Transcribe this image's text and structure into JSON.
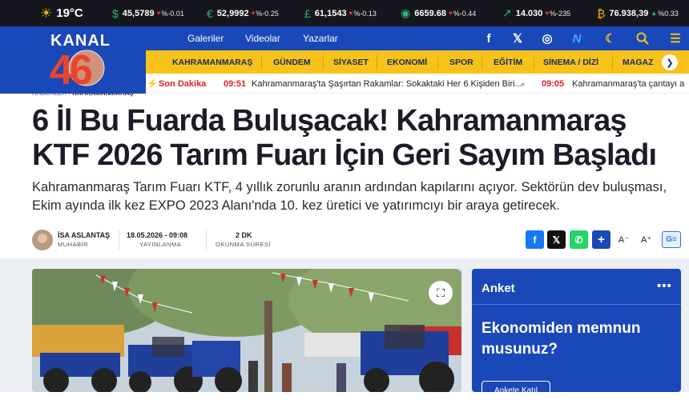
{
  "ticker": {
    "weather": {
      "temp": "19°C",
      "icon": "sun-icon"
    },
    "items": [
      {
        "icon": "dollar-icon",
        "symbol": "$",
        "value": "45,5789",
        "change": "%-0.01",
        "dir": "down"
      },
      {
        "icon": "euro-icon",
        "symbol": "€",
        "value": "52,9992",
        "change": "%-0.25",
        "dir": "down"
      },
      {
        "icon": "pound-icon",
        "symbol": "£",
        "value": "61,1543",
        "change": "%-0.13",
        "dir": "down"
      },
      {
        "icon": "gold-icon",
        "symbol": "◉",
        "value": "6659.68",
        "change": "%-0.44",
        "dir": "down"
      },
      {
        "icon": "chart-icon",
        "symbol": "↗",
        "value": "14.030",
        "change": "%-235",
        "dir": "down"
      },
      {
        "icon": "bitcoin-icon",
        "symbol": "₿",
        "value": "76.938,39",
        "change": "%0.33",
        "dir": "up"
      }
    ]
  },
  "header": {
    "logo_top": "KANAL",
    "logo_num": "46",
    "nav": [
      "Galeriler",
      "Videolar",
      "Yazarlar"
    ]
  },
  "categories": [
    "KAHRAMANMARAŞ",
    "GÜNDEM",
    "SİYASET",
    "EKONOMİ",
    "SPOR",
    "EĞİTİM",
    "SİNEMA / DİZİ",
    "MAGAZ"
  ],
  "breaking": {
    "label": "Son Dakika",
    "items": [
      {
        "time": "09:51",
        "text": "Kahramanmaraş'ta Şaşırtan Rakamlar: Sokaktaki Her 6 Kişiden Biri..."
      },
      {
        "time": "09:05",
        "text": "Kahramanmaraş'ta çantayı a"
      }
    ]
  },
  "breadcrumb": {
    "home": "HABERLER",
    "sep": "›",
    "current": "KAHRAMANMARAŞ"
  },
  "article": {
    "title": "6 İl Bu Fuarda Buluşacak! Kahramanmaraş KTF 2026 Tarım Fuarı İçin Geri Sayım Başladı",
    "spot": "Kahramanmaraş Tarım Fuarı KTF, 4 yıllık zorunlu aranın ardından kapılarını açıyor. Sektörün dev buluşması, Ekim ayında ilk kez EXPO 2023 Alanı'nda 10. kez üretici ve yatırımcıyı bir araya getirecek."
  },
  "meta": {
    "author": "İSA ASLANTAŞ",
    "role": "MUHABİR",
    "date": "18.05.2026 - 09:08",
    "date_label": "YAYINLANMA",
    "read": "2 DK",
    "read_label": "OKUNMA SÜRESİ"
  },
  "share": {
    "font_smaller": "A⁻",
    "font_larger": "A⁺",
    "google": "G≡"
  },
  "poll": {
    "title": "Anket",
    "question": "Ekonomiden memnun musunuz?",
    "button": "Ankete Katıl"
  },
  "colors": {
    "brand_blue": "#1a48b8",
    "accent_yellow": "#f7c21a",
    "breaking_red": "#e01f26"
  }
}
